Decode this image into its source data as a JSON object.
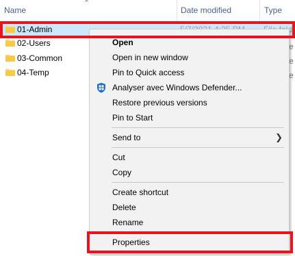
{
  "columns": {
    "name": "Name",
    "date_modified": "Date modified",
    "type": "Type"
  },
  "files": [
    {
      "name": "01-Admin",
      "date": "5/7/2021 4:25 PM",
      "type": "File fold",
      "selected": true
    },
    {
      "name": "02-Users"
    },
    {
      "name": "03-Common"
    },
    {
      "name": "04-Temp"
    }
  ],
  "type_peek": "e",
  "context_menu": {
    "items": [
      {
        "label": "Open",
        "bold": true
      },
      {
        "label": "Open in new window"
      },
      {
        "label": "Pin to Quick access"
      },
      {
        "label": "Analyser avec Windows Defender...",
        "icon": "windows-defender-icon"
      },
      {
        "label": "Restore previous versions"
      },
      {
        "label": "Pin to Start"
      },
      {
        "label": "Send to",
        "submenu": true
      },
      {
        "label": "Cut"
      },
      {
        "label": "Copy"
      },
      {
        "label": "Create shortcut"
      },
      {
        "label": "Delete"
      },
      {
        "label": "Rename"
      },
      {
        "label": "Properties"
      }
    ],
    "submenu_arrow": "❯"
  },
  "colors": {
    "highlight": "#e8141b",
    "selection": "#cce8ff",
    "header_text": "#4d6185",
    "folder": "#ffd766"
  }
}
